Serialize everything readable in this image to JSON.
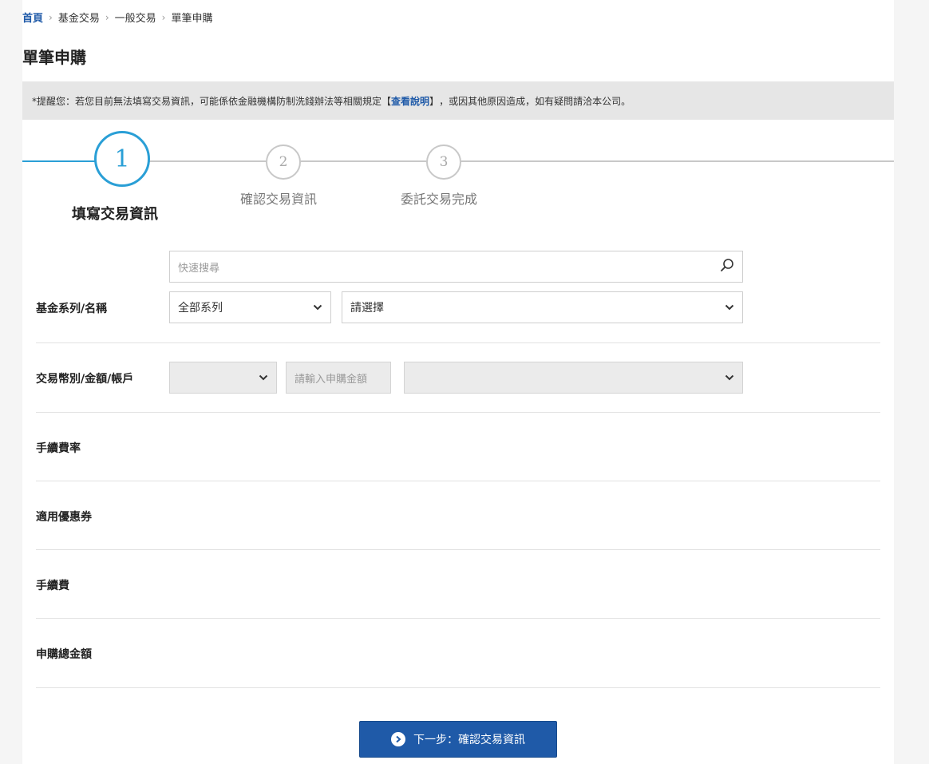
{
  "breadcrumb": {
    "home": "首頁",
    "item1": "基金交易",
    "item2": "一般交易",
    "item3": "單筆申購",
    "separator": "›"
  },
  "page_title": "單筆申購",
  "notice": {
    "prefix": "*提醒您：若您目前無法填寫交易資訊，可能係依金融機構防制洗錢辦法等相關規定",
    "bracket_open": "【",
    "link": "查看說明",
    "bracket_close": "】",
    "suffix": "，或因其他原因造成，如有疑問請洽本公司。"
  },
  "steps": [
    {
      "number": "1",
      "label": "填寫交易資訊",
      "status": "active"
    },
    {
      "number": "2",
      "label": "確認交易資訊",
      "status": "pending"
    },
    {
      "number": "3",
      "label": "委託交易完成",
      "status": "pending"
    }
  ],
  "form": {
    "search": {
      "placeholder": "快速搜尋",
      "icon": "search-icon"
    },
    "fund_label": "基金系列/名稱",
    "series_select": {
      "selected": "全部系列"
    },
    "fund_select": {
      "selected": "請選擇"
    },
    "currency_label": "交易幣別/金額/帳戶",
    "currency_select": {
      "selected": ""
    },
    "amount_input": {
      "placeholder": "請輸入申購金額"
    },
    "account_select": {
      "selected": ""
    },
    "fee_rate_label": "手續費率",
    "coupon_label": "適用優惠券",
    "fee_label": "手續費",
    "total_label": "申購總金額"
  },
  "next_button": {
    "label": "下一步：確認交易資訊",
    "icon": "chevron-right-circle-icon"
  },
  "colors": {
    "accent": "#2a9fd6",
    "primary_button": "#1f5aa8",
    "link": "#1f5aa8",
    "notice_bg": "#e6e6e6"
  }
}
